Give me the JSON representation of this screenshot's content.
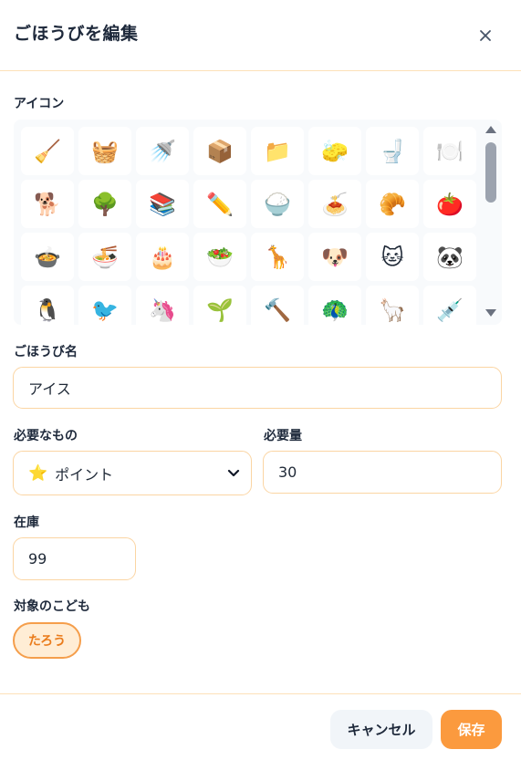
{
  "dialog": {
    "title": "ごほうびを編集",
    "close_icon": "close-icon"
  },
  "icons": {
    "label": "アイコン",
    "items": [
      "🧹",
      "🧺",
      "🚿",
      "📦",
      "📁",
      "🧽",
      "🚽",
      "🍽️",
      "🐕",
      "🌳",
      "📚",
      "✏️",
      "🍚",
      "🍝",
      "🥐",
      "🍅",
      "🍲",
      "🍜",
      "🎂",
      "🥗",
      "🦒",
      "🐶",
      "🐱",
      "🐼",
      "🐧",
      "🐦",
      "🦄",
      "🌱",
      "🔨",
      "🦚",
      "🦙",
      "💉"
    ]
  },
  "reward_name": {
    "label": "ごほうび名",
    "value": "アイス"
  },
  "required_item": {
    "label": "必要なもの",
    "icon": "⭐",
    "value": "ポイント"
  },
  "required_amount": {
    "label": "必要量",
    "value": "30"
  },
  "stock": {
    "label": "在庫",
    "value": "99"
  },
  "target_child": {
    "label": "対象のこども",
    "chips": [
      "たろう"
    ]
  },
  "footer": {
    "cancel_label": "キャンセル",
    "save_label": "保存"
  },
  "colors": {
    "accent": "#fb9a3e",
    "accent_border": "#fbd5a3",
    "chip_bg": "#ffedd5",
    "chip_text": "#ea7c1c"
  }
}
